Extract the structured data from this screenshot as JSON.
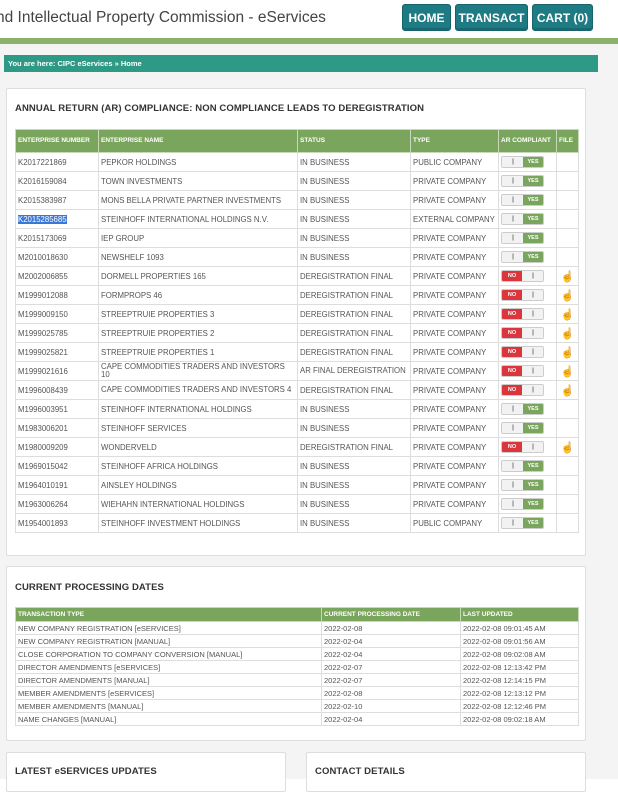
{
  "header": {
    "site_title": "nd Intellectual Property Commission - eServices",
    "nav": [
      {
        "label": "HOME"
      },
      {
        "label": "TRANSACT"
      },
      {
        "label": "CART (0)"
      }
    ]
  },
  "breadcrumb": {
    "prefix": "You are here:",
    "path": "CIPC eServices » Home"
  },
  "ar_panel": {
    "title": "ANNUAL RETURN (AR) COMPLIANCE: NON COMPLIANCE LEADS TO DEREGISTRATION",
    "columns": [
      "ENTERPRISE NUMBER",
      "ENTERPRISE NAME",
      "STATUS",
      "TYPE",
      "AR COMPLIANT",
      "FILE"
    ],
    "toggle_yes": "YES",
    "toggle_no": "NO",
    "rows": [
      {
        "number": "K2017221869",
        "name": "PEPKOR HOLDINGS",
        "status": "IN BUSINESS",
        "type": "PUBLIC COMPANY",
        "compliant": true
      },
      {
        "number": "K2016159084",
        "name": "TOWN INVESTMENTS",
        "status": "IN BUSINESS",
        "type": "PRIVATE COMPANY",
        "compliant": true
      },
      {
        "number": "K2015383987",
        "name": "MONS BELLA PRIVATE PARTNER INVESTMENTS",
        "status": "IN BUSINESS",
        "type": "PRIVATE COMPANY",
        "compliant": true
      },
      {
        "number": "K2015285685",
        "name": "STEINHOFF INTERNATIONAL HOLDINGS N.V.",
        "status": "IN BUSINESS",
        "type": "EXTERNAL COMPANY",
        "compliant": true,
        "selected": true
      },
      {
        "number": "K2015173069",
        "name": "IEP GROUP",
        "status": "IN BUSINESS",
        "type": "PRIVATE COMPANY",
        "compliant": true
      },
      {
        "number": "M2010018630",
        "name": "NEWSHELF 1093",
        "status": "IN BUSINESS",
        "type": "PRIVATE COMPANY",
        "compliant": true
      },
      {
        "number": "M2002006855",
        "name": "DORMELL PROPERTIES 165",
        "status": "DEREGISTRATION FINAL",
        "type": "PRIVATE COMPANY",
        "compliant": false
      },
      {
        "number": "M1999012088",
        "name": "FORMPROPS 46",
        "status": "DEREGISTRATION FINAL",
        "type": "PRIVATE COMPANY",
        "compliant": false
      },
      {
        "number": "M1999009150",
        "name": "STREEPTRUIE PROPERTIES 3",
        "status": "DEREGISTRATION FINAL",
        "type": "PRIVATE COMPANY",
        "compliant": false
      },
      {
        "number": "M1999025785",
        "name": "STREEPTRUIE PROPERTIES 2",
        "status": "DEREGISTRATION FINAL",
        "type": "PRIVATE COMPANY",
        "compliant": false
      },
      {
        "number": "M1999025821",
        "name": "STREEPTRUIE PROPERTIES 1",
        "status": "DEREGISTRATION FINAL",
        "type": "PRIVATE COMPANY",
        "compliant": false
      },
      {
        "number": "M1999021616",
        "name": "CAPE COMMODITIES TRADERS AND INVESTORS 10",
        "status": "AR FINAL DEREGISTRATION",
        "type": "PRIVATE COMPANY",
        "compliant": false
      },
      {
        "number": "M1996008439",
        "name": "CAPE COMMODITIES TRADERS AND INVESTORS 4",
        "status": "DEREGISTRATION FINAL",
        "type": "PRIVATE COMPANY",
        "compliant": false
      },
      {
        "number": "M1996003951",
        "name": "STEINHOFF INTERNATIONAL HOLDINGS",
        "status": "IN BUSINESS",
        "type": "PRIVATE COMPANY",
        "compliant": true
      },
      {
        "number": "M1983006201",
        "name": "STEINHOFF SERVICES",
        "status": "IN BUSINESS",
        "type": "PRIVATE COMPANY",
        "compliant": true
      },
      {
        "number": "M1980009209",
        "name": "WONDERVELD",
        "status": "DEREGISTRATION FINAL",
        "type": "PRIVATE COMPANY",
        "compliant": false
      },
      {
        "number": "M1969015042",
        "name": "STEINHOFF AFRICA HOLDINGS",
        "status": "IN BUSINESS",
        "type": "PRIVATE COMPANY",
        "compliant": true
      },
      {
        "number": "M1964010191",
        "name": "AINSLEY HOLDINGS",
        "status": "IN BUSINESS",
        "type": "PRIVATE COMPANY",
        "compliant": true
      },
      {
        "number": "M1963006264",
        "name": "WIEHAHN INTERNATIONAL HOLDINGS",
        "status": "IN BUSINESS",
        "type": "PRIVATE COMPANY",
        "compliant": true
      },
      {
        "number": "M1954001893",
        "name": "STEINHOFF INVESTMENT HOLDINGS",
        "status": "IN BUSINESS",
        "type": "PUBLIC COMPANY",
        "compliant": true
      }
    ]
  },
  "dates_panel": {
    "title": "CURRENT PROCESSING DATES",
    "columns": [
      "TRANSACTION TYPE",
      "CURRENT PROCESSING DATE",
      "LAST UPDATED"
    ],
    "rows": [
      {
        "type": "NEW COMPANY REGISTRATION [eSERVICES]",
        "date": "2022-02-08",
        "updated": "2022-02-08 09:01:45 AM"
      },
      {
        "type": "NEW COMPANY REGISTRATION [MANUAL]",
        "date": "2022-02-04",
        "updated": "2022-02-08 09:01:56 AM"
      },
      {
        "type": "CLOSE CORPORATION TO COMPANY CONVERSION [MANUAL]",
        "date": "2022-02-04",
        "updated": "2022-02-08 09:02:08 AM"
      },
      {
        "type": "DIRECTOR AMENDMENTS [eSERVICES]",
        "date": "2022-02-07",
        "updated": "2022-02-08 12:13:42 PM"
      },
      {
        "type": "DIRECTOR AMENDMENTS [MANUAL]",
        "date": "2022-02-07",
        "updated": "2022-02-08 12:14:15 PM"
      },
      {
        "type": "MEMBER AMENDMENTS [eSERVICES]",
        "date": "2022-02-08",
        "updated": "2022-02-08 12:13:12 PM"
      },
      {
        "type": "MEMBER AMENDMENTS [MANUAL]",
        "date": "2022-02-10",
        "updated": "2022-02-08 12:12:46 PM"
      },
      {
        "type": "NAME CHANGES [MANUAL]",
        "date": "2022-02-04",
        "updated": "2022-02-08 09:02:18 AM"
      }
    ]
  },
  "bottom_panels": {
    "updates_title": "LATEST eSERVICES UPDATES",
    "contact_title": "CONTACT DETAILS"
  },
  "colors": {
    "header_green": "#7aa55d",
    "nav_teal": "#1e7b83",
    "breadcrumb_teal": "#2e9a86",
    "no_red": "#d9363e",
    "hand_blue": "#4f8fd6"
  }
}
